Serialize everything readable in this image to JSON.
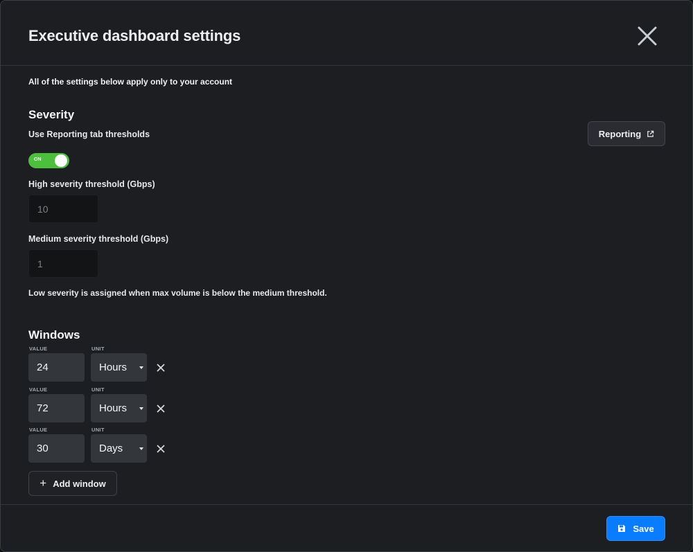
{
  "dialog": {
    "title": "Executive dashboard settings",
    "subtitle": "All of the settings below apply only to your account"
  },
  "severity": {
    "title": "Severity",
    "use_reporting_label": "Use Reporting tab thresholds",
    "toggle_text": "ON",
    "toggle_on": true,
    "reporting_button": "Reporting",
    "high_label": "High severity threshold (Gbps)",
    "high_value": "10",
    "medium_label": "Medium severity threshold (Gbps)",
    "medium_value": "1",
    "note": "Low severity is assigned when max volume is below the medium threshold."
  },
  "windows": {
    "title": "Windows",
    "value_label": "VALUE",
    "unit_label": "UNIT",
    "items": [
      {
        "value": "24",
        "unit": "Hours"
      },
      {
        "value": "72",
        "unit": "Hours"
      },
      {
        "value": "30",
        "unit": "Days"
      }
    ],
    "add_button": "Add window"
  },
  "footer": {
    "save_button": "Save"
  },
  "colors": {
    "accent": "#0a7cff",
    "toggle_on": "#4cc03c",
    "background": "#1c1e22"
  },
  "icons": [
    "close-icon",
    "external-link-icon",
    "remove-icon",
    "plus-icon",
    "save-icon"
  ]
}
